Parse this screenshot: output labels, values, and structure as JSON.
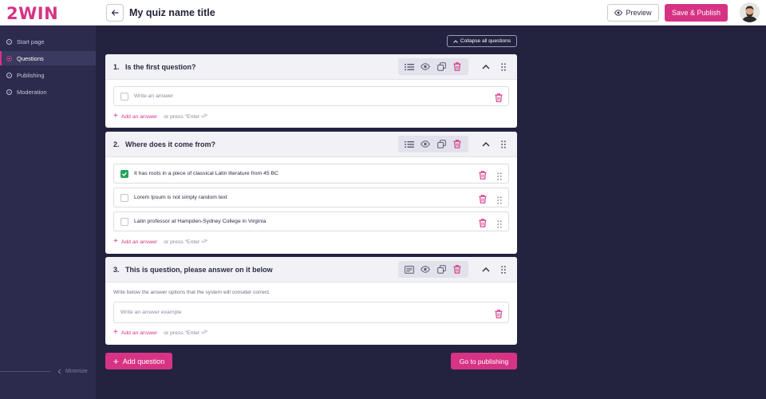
{
  "app": {
    "logo": "2WIN"
  },
  "header": {
    "title": "My quiz name title",
    "preview_label": "Preview",
    "publish_label": "Save & Publish"
  },
  "sidebar": {
    "items": [
      {
        "label": "Start page",
        "active": false
      },
      {
        "label": "Questions",
        "active": true
      },
      {
        "label": "Publishing",
        "active": false
      },
      {
        "label": "Moderation",
        "active": false
      }
    ],
    "minimize_label": "Minimize"
  },
  "toolbar": {
    "collapse_all_label": "Collapse all questions"
  },
  "questions": [
    {
      "number": "1.",
      "title": "Is the first question?",
      "answers": [
        {
          "text": "Write an answer",
          "placeholder": true,
          "checked": false
        }
      ],
      "add_label": "Add an answer",
      "add_hint": "or press \"Enter ⏎\""
    },
    {
      "number": "2.",
      "title": "Where does it come from?",
      "answers": [
        {
          "text": "It has roots in a piece of classical Latin literature from 45 BC",
          "placeholder": false,
          "checked": true
        },
        {
          "text": "Lorem Ipsum is not simply random text",
          "placeholder": false,
          "checked": false
        },
        {
          "text": "Latin professor at Hampden-Sydney College in Virginia",
          "placeholder": false,
          "checked": false
        }
      ],
      "add_label": "Add an answer",
      "add_hint": "or press \"Enter ⏎\""
    },
    {
      "number": "3.",
      "title": "This is question, please answer on it below",
      "note": "Write below the answer options that the system will consider correct.",
      "answers": [
        {
          "text": "Write an answer example",
          "placeholder": true
        }
      ],
      "add_label": "Add an answer",
      "add_hint": "or press \"Enter ⏎\""
    }
  ],
  "footer": {
    "add_question_label": "Add question",
    "go_publishing_label": "Go to publishing"
  },
  "colors": {
    "accent": "#d63384",
    "sidebar_bg": "#2c2b4d",
    "canvas_bg": "#23223f",
    "check_green": "#27a35b"
  }
}
